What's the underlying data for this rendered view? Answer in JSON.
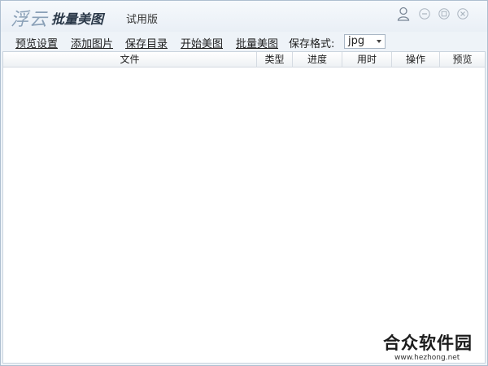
{
  "titlebar": {
    "logo_mark": "浮云",
    "app_name": "批量美图",
    "edition": "试用版"
  },
  "toolbar": {
    "preview_settings": "预览设置",
    "add_images": "添加图片",
    "save_dir": "保存目录",
    "start": "开始美图",
    "batch": "批量美图",
    "format_label": "保存格式:",
    "format_value": "jpg"
  },
  "table": {
    "columns": [
      "文件",
      "类型",
      "进度",
      "用时",
      "操作",
      "预览"
    ]
  },
  "watermark": {
    "title": "合众软件园",
    "url": "www.hezhong.net"
  }
}
